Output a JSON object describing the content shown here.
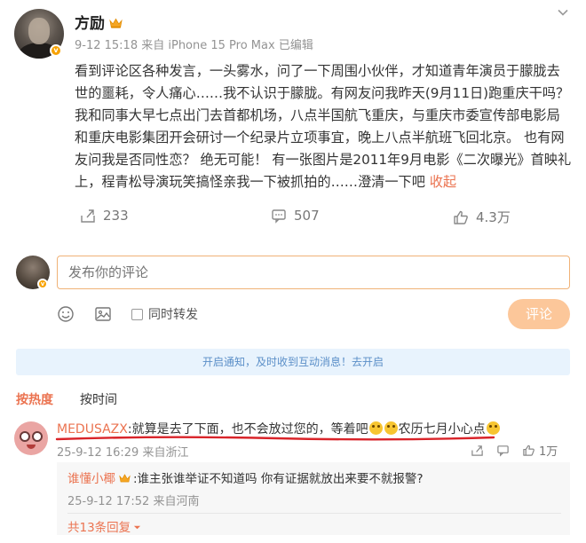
{
  "post": {
    "author": "方励",
    "meta": "9-12 15:18 来自 iPhone 15 Pro Max 已编辑",
    "text": "看到评论区各种发言，一头雾水，问了一下周围小伙伴，才知道青年演员于朦胧去世的噩耗，令人痛心……我不认识于朦胧。有网友问我昨天(9月11日)跑重庆干吗？我和同事大早七点出门去首都机场，八点半国航飞重庆，与重庆市委宣传部电影局和重庆电影集团开会研讨一个纪录片立项事宜，晚上八点半航班飞回北京。 也有网友问我是否同性恋？ 绝无可能！ 有一张图片是2011年9月电影《二次曝光》首映礼上，程青松导演玩笑搞怪亲我一下被抓拍的……澄清一下吧",
    "collapse_label": "收起",
    "repost_count": "233",
    "comment_count": "507",
    "like_count": "4.3万"
  },
  "composer": {
    "placeholder": "发布你的评论",
    "repost_label": "同时转发",
    "submit_label": "评论"
  },
  "notice": {
    "text": "开启通知，及时收到互动消息！去开启"
  },
  "sort": {
    "hot": "按热度",
    "time": "按时间"
  },
  "comment": {
    "user": "MEDUSAZX",
    "text_a": ":就算是去了下面，也不会放过您的，等着吧",
    "text_b": "农历七月小心点",
    "meta": "25-9-12 16:29 来自浙江",
    "like_count": "1万"
  },
  "reply": {
    "user": "谁懂小椰",
    "text": ":谁主张谁举证不知道吗 你有证据就放出来要不就报警?",
    "meta": "25-9-12 17:52 来自河南",
    "more_label": "共13条回复"
  },
  "colors": {
    "accent": "#eb7350",
    "notice_bg": "#e8f3fd",
    "underline": "#d9242a"
  }
}
